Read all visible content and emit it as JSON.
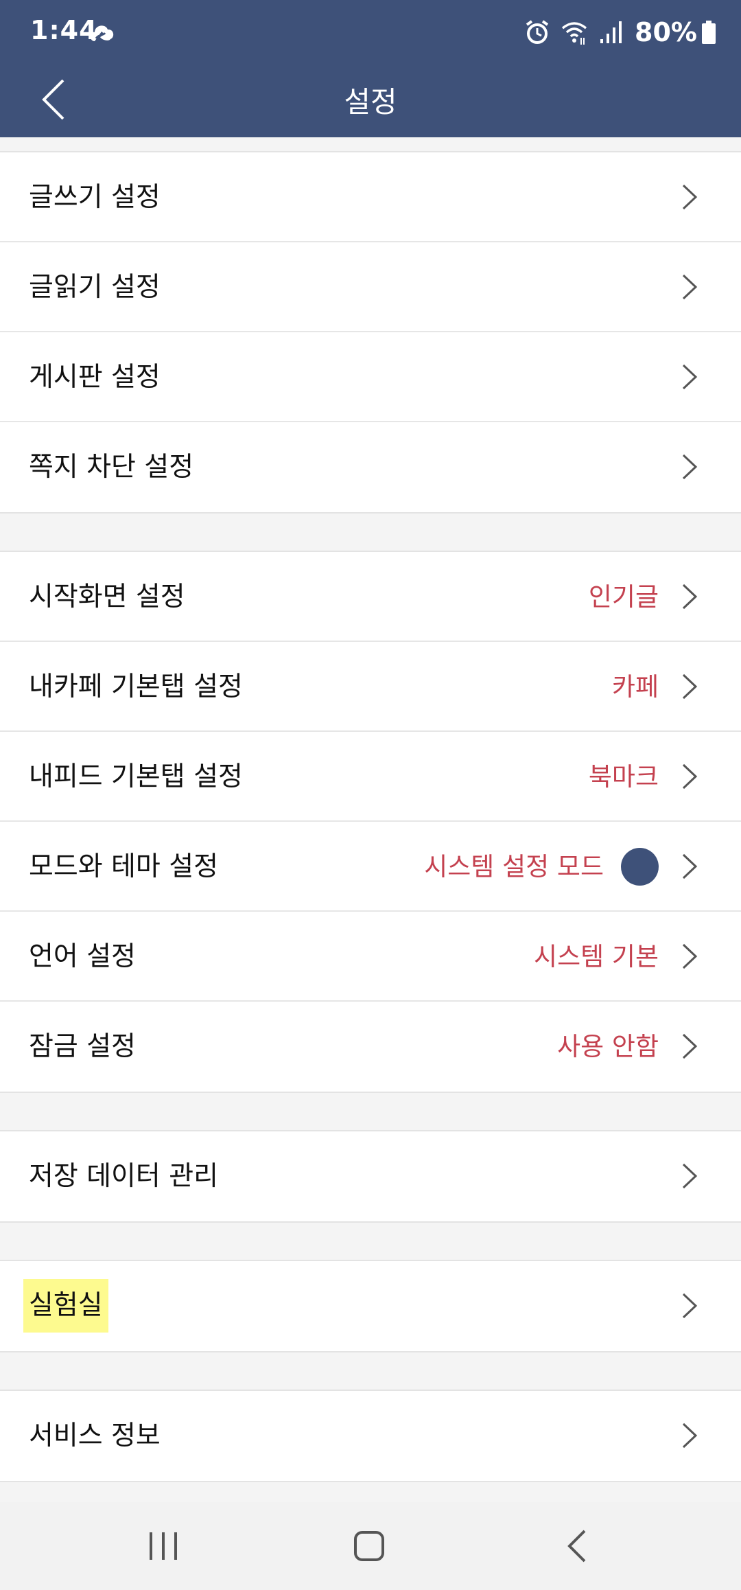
{
  "status_bar": {
    "time": "1:44",
    "battery": "80%",
    "icons": [
      "cloud-icon",
      "alarm-icon",
      "wifi-icon",
      "signal-icon",
      "battery-icon"
    ]
  },
  "header": {
    "title": "설정",
    "back_icon": "chevron-left-icon",
    "bg_color": "#3e5179"
  },
  "groups": [
    {
      "items": [
        {
          "label": "글쓰기 설정",
          "value": ""
        },
        {
          "label": "글읽기 설정",
          "value": ""
        },
        {
          "label": "게시판 설정",
          "value": ""
        },
        {
          "label": "쪽지 차단 설정",
          "value": ""
        }
      ]
    },
    {
      "items": [
        {
          "label": "시작화면 설정",
          "value": "인기글"
        },
        {
          "label": "내카페 기본탭 설정",
          "value": "카페"
        },
        {
          "label": "내피드 기본탭 설정",
          "value": "북마크"
        },
        {
          "label": "모드와 테마 설정",
          "value": "시스템 설정 모드"
        },
        {
          "label": "언어 설정",
          "value": "시스템 기본"
        },
        {
          "label": "잠금 설정",
          "value": "사용 안함"
        }
      ]
    },
    {
      "items": [
        {
          "label": "저장 데이터 관리",
          "value": ""
        }
      ]
    },
    {
      "items": [
        {
          "label": "실험실",
          "value": ""
        }
      ]
    },
    {
      "items": [
        {
          "label": "서비스 정보",
          "value": ""
        }
      ]
    }
  ],
  "colors": {
    "accent_value": "#c4414f",
    "theme_dot": "#3e5179",
    "highlight": "#fdfa8f"
  },
  "nav_bar": {
    "icons": [
      "recent-apps-icon",
      "home-icon",
      "back-icon"
    ]
  }
}
